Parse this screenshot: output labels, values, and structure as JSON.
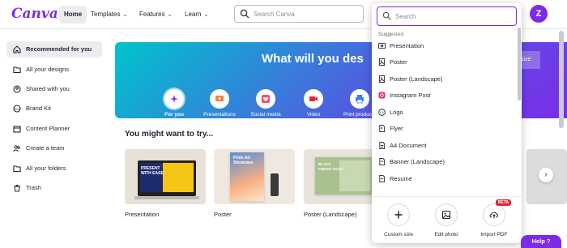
{
  "app": {
    "logo_text": "Canva",
    "brand_color": "#7d2ae8"
  },
  "nav": {
    "home": "Home",
    "templates": "Templates",
    "features": "Features",
    "learn": "Learn"
  },
  "search": {
    "placeholder": "Search Canva"
  },
  "user": {
    "avatar_initial": "Z"
  },
  "sidebar": {
    "items": [
      {
        "label": "Recommended for you",
        "icon": "home-icon"
      },
      {
        "label": "All your designs",
        "icon": "folder-icon"
      },
      {
        "label": "Shared with you",
        "icon": "people-icon"
      },
      {
        "label": "Brand Kit",
        "icon": "brand-kit-icon"
      },
      {
        "label": "Content Planner",
        "icon": "calendar-icon"
      },
      {
        "label": "Create a team",
        "icon": "team-icon"
      },
      {
        "label": "All your folders",
        "icon": "folder-icon"
      },
      {
        "label": "Trash",
        "icon": "trash-icon"
      }
    ]
  },
  "hero": {
    "title": "What will you des",
    "size_button": "size",
    "categories": [
      {
        "label": "For you",
        "icon": "sparkle-icon"
      },
      {
        "label": "Presentations",
        "icon": "presentation-icon"
      },
      {
        "label": "Social media",
        "icon": "heart-icon"
      },
      {
        "label": "Video",
        "icon": "video-icon"
      },
      {
        "label": "Print products",
        "icon": "printer-icon"
      }
    ]
  },
  "suggestions": {
    "title": "You might want to try...",
    "cards": [
      {
        "label": "Presentation",
        "thumb_text": "PRESENT\nWITH EASE"
      },
      {
        "label": "Poster",
        "thumb_text": "Pride Art\nShowcase"
      },
      {
        "label": "Poster (Landscape)",
        "thumb_text": "BLACK\nFRIDAY SALE!"
      }
    ]
  },
  "dropdown": {
    "search_placeholder": "Search",
    "suggested_label": "Suggested",
    "items": [
      {
        "label": "Presentation",
        "icon": "presentation-icon"
      },
      {
        "label": "Poster",
        "icon": "poster-icon"
      },
      {
        "label": "Poster (Landscape)",
        "icon": "poster-icon"
      },
      {
        "label": "Instagram Post",
        "icon": "instagram-icon"
      },
      {
        "label": "Logo",
        "icon": "logo-icon"
      },
      {
        "label": "Flyer",
        "icon": "flyer-icon"
      },
      {
        "label": "A4 Document",
        "icon": "document-icon"
      },
      {
        "label": "Banner (Landscape)",
        "icon": "banner-icon"
      },
      {
        "label": "Resume",
        "icon": "resume-icon"
      }
    ],
    "actions": [
      {
        "label": "Custom size",
        "icon": "plus-icon"
      },
      {
        "label": "Edit photo",
        "icon": "image-icon"
      },
      {
        "label": "Import PDF",
        "icon": "upload-icon",
        "badge": "BETA"
      }
    ]
  },
  "help": {
    "label": "Help ?"
  }
}
